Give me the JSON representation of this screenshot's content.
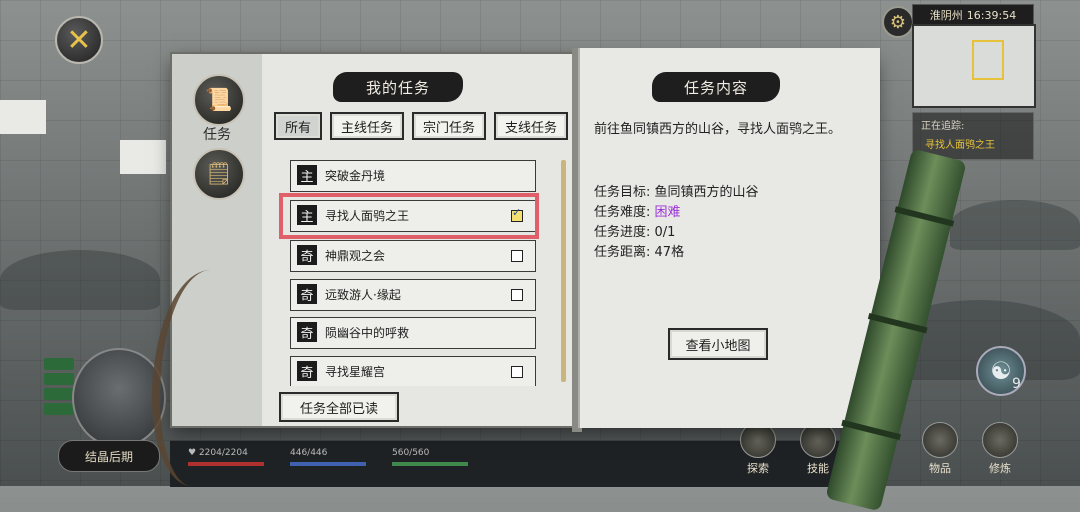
{
  "top_right": {
    "time": "16:39:54",
    "location": "淮阴州",
    "tracking_label": "正在追踪:",
    "tracking_quest": "寻找人面鸮之王"
  },
  "sidebar": {
    "quest_label": "任务"
  },
  "left_page": {
    "title": "我的任务",
    "tabs": [
      {
        "label": "所有",
        "active": true
      },
      {
        "label": "主线任务",
        "active": false
      },
      {
        "label": "宗门任务",
        "active": false
      },
      {
        "label": "支线任务",
        "active": false
      }
    ],
    "quests": [
      {
        "type": "主",
        "name": "突破金丹境",
        "has_checkbox": false,
        "checked": false
      },
      {
        "type": "主",
        "name": "寻找人面鸮之王",
        "has_checkbox": true,
        "checked": true
      },
      {
        "type": "奇",
        "name": "神鼎观之会",
        "has_checkbox": true,
        "checked": false
      },
      {
        "type": "奇",
        "name": "远致游人·缘起",
        "has_checkbox": true,
        "checked": false
      },
      {
        "type": "奇",
        "name": "陨幽谷中的呼救",
        "has_checkbox": false,
        "checked": false
      },
      {
        "type": "奇",
        "name": "寻找星耀宫",
        "has_checkbox": true,
        "checked": false
      }
    ],
    "read_all_label": "任务全部已读"
  },
  "right_page": {
    "title": "任务内容",
    "description": "前往鱼同镇西方的山谷，寻找人面鸮之王。",
    "details": [
      {
        "label": "任务目标:",
        "value": "鱼同镇西方的山谷"
      },
      {
        "label": "任务难度:",
        "value": "困难"
      },
      {
        "label": "任务进度:",
        "value": "0/1"
      },
      {
        "label": "任务距离:",
        "value": "47格"
      }
    ],
    "view_map_label": "查看小地图"
  },
  "bottom": {
    "realm_label": "结晶后期",
    "hp": "2204/2204",
    "mp": "446/446",
    "sp": "560/560",
    "buttons": [
      "探索",
      "技能",
      "物品",
      "修炼"
    ],
    "yinyang_count": "9"
  },
  "colors": {
    "highlight": "#e0606a",
    "difficulty_hard": "#9b30d8"
  }
}
